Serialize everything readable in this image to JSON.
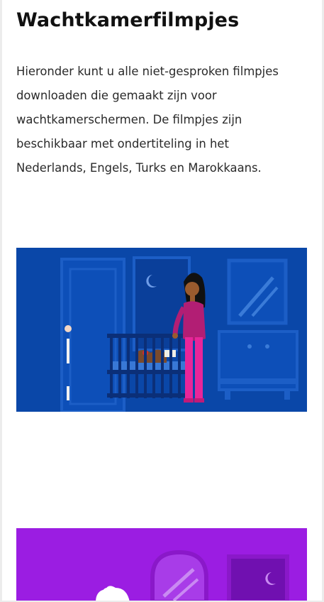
{
  "page": {
    "title": "Wachtkamerfilmpjes",
    "intro_lines": [
      "Hieronder kunt u alle niet-gesproken filmpjes",
      "downloaden die gemaakt zijn voor",
      "wachtkamerschermen. De filmpjes zijn",
      "beschikbaar met ondertiteling in het",
      "Nederlands, Engels, Turks en Marokkaans."
    ]
  },
  "videos": [
    {
      "scene": "nursery-night",
      "colors": {
        "background": "#0a47a8",
        "accent": "#e8259a"
      }
    },
    {
      "scene": "room-purple",
      "colors": {
        "background": "#9b1de2",
        "accent": "#c98af2"
      }
    }
  ]
}
